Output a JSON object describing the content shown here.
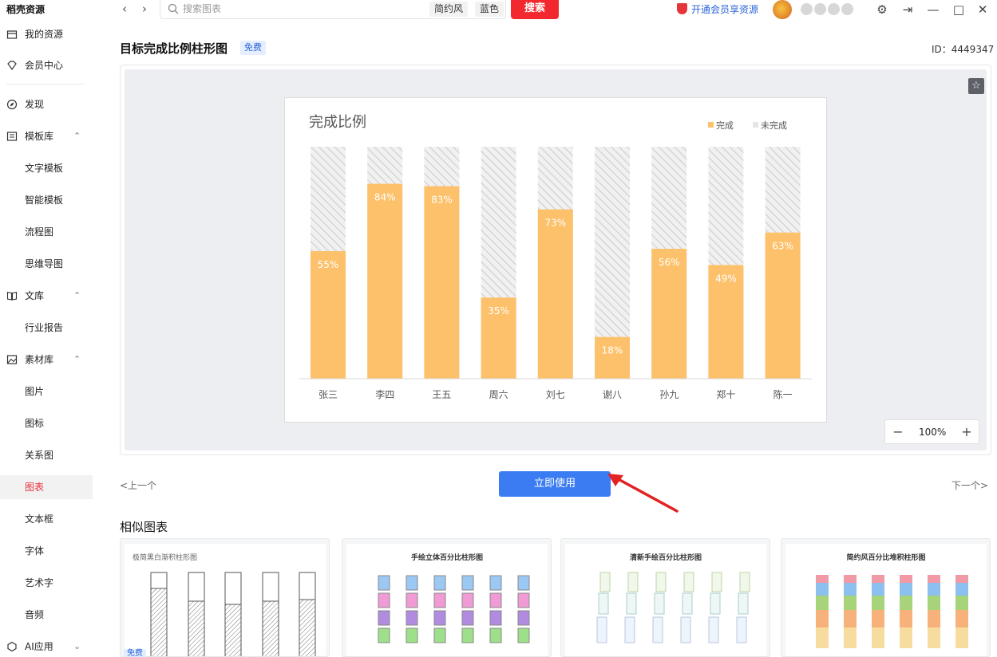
{
  "app": {
    "brand": "稻壳资源"
  },
  "search": {
    "placeholder": "搜索图表",
    "tag1": "简约风",
    "tag2": "蓝色",
    "button": "搜索"
  },
  "header": {
    "vip_text": "开通会员享资源"
  },
  "sidebar": {
    "items": [
      {
        "label": "我的资源",
        "icon": "box-icon"
      },
      {
        "label": "会员中心",
        "icon": "diamond-icon"
      },
      {
        "label": "发现",
        "icon": "compass-icon"
      },
      {
        "label": "模板库",
        "icon": "template-icon"
      },
      {
        "label": "文字模板"
      },
      {
        "label": "智能模板"
      },
      {
        "label": "流程图"
      },
      {
        "label": "思维导图"
      },
      {
        "label": "文库",
        "icon": "book-icon"
      },
      {
        "label": "行业报告"
      },
      {
        "label": "素材库",
        "icon": "image-icon"
      },
      {
        "label": "图片"
      },
      {
        "label": "图标"
      },
      {
        "label": "关系图"
      },
      {
        "label": "图表"
      },
      {
        "label": "文本框"
      },
      {
        "label": "字体"
      },
      {
        "label": "艺术字"
      },
      {
        "label": "音频"
      },
      {
        "label": "AI应用",
        "icon": "ai-icon"
      }
    ]
  },
  "main": {
    "title": "目标完成比例柱形图",
    "free_tag": "免费",
    "id_text": "ID：4449347",
    "zoom": "100%",
    "prev": "<上一个",
    "next": "下一个>",
    "use_button": "立即使用",
    "similar_title": "相似图表",
    "free_badge": "免费"
  },
  "thumbnails": [
    {
      "title": "极简黑白渐积柱形图"
    },
    {
      "title": "手绘立体百分比柱形图"
    },
    {
      "title": "清新手绘百分比柱形图"
    },
    {
      "title": "简约风百分比堆积柱形图"
    }
  ],
  "colors": {
    "accent_red": "#f3282f",
    "primary_blue": "#3b7cf2",
    "bar_done": "#fcc16a",
    "bar_rest": "#e5e5e5"
  },
  "chart_data": {
    "type": "bar",
    "title": "完成比例",
    "categories": [
      "张三",
      "李四",
      "王五",
      "周六",
      "刘七",
      "谢八",
      "孙九",
      "郑十",
      "陈一"
    ],
    "series": [
      {
        "name": "完成",
        "values": [
          55,
          84,
          83,
          35,
          73,
          18,
          56,
          49,
          63
        ]
      },
      {
        "name": "未完成",
        "values": [
          45,
          16,
          17,
          65,
          27,
          82,
          44,
          51,
          37
        ]
      }
    ],
    "data_labels": [
      "55%",
      "84%",
      "83%",
      "35%",
      "73%",
      "18%",
      "56%",
      "49%",
      "63%"
    ],
    "ylim": [
      0,
      100
    ],
    "stacked": true,
    "legend_position": "top-right",
    "grid": false
  }
}
